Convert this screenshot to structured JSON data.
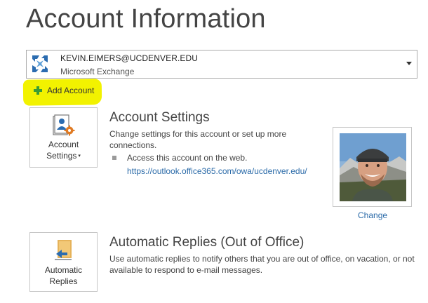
{
  "header": {
    "title": "Account Information"
  },
  "account": {
    "email": "KEVIN.EIMERS@UCDENVER.EDU",
    "type": "Microsoft Exchange",
    "icon": "exchange-icon"
  },
  "add_account": {
    "label": "Add Account",
    "icon": "plus-icon",
    "highlight_color": "#f2f200"
  },
  "account_settings": {
    "tile_label_line1": "Account",
    "tile_label_line2": "Settings",
    "tile_caret": "▾",
    "title": "Account Settings",
    "description": "Change settings for this account or set up more connections.",
    "web_access_text": "Access this account on the web.",
    "web_link": "https://outlook.office365.com/owa/ucdenver.edu/",
    "change_photo_label": "Change"
  },
  "automatic_replies": {
    "tile_label_line1": "Automatic",
    "tile_label_line2": "Replies",
    "title": "Automatic Replies (Out of Office)",
    "description": "Use automatic replies to notify others that you are out of office, on vacation, or not available to respond to e-mail messages."
  },
  "colors": {
    "link": "#2a6aa8",
    "exchange_blue": "#2b6cb0",
    "accent_green": "#3a9c35"
  }
}
